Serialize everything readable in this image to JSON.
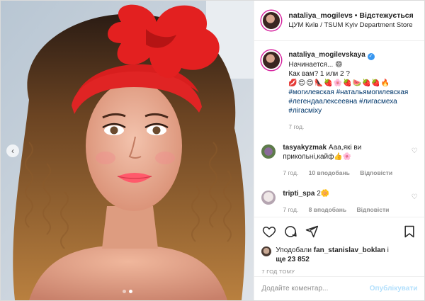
{
  "post": {
    "photo_alt": "",
    "carousel": {
      "count": 2,
      "active": 1
    },
    "header": {
      "username": "nataliya_mogilevs",
      "separator": "•",
      "follow_label": "Відстежується",
      "location": "ЦУМ Київ / TSUM Kyiv Department Store"
    },
    "caption": {
      "username": "nataliya_mogilevskaya",
      "line1": "Начинается... 😄",
      "line2": "Как вам? 1 или 2 ?",
      "emoji_line": "💋😍😍👠🍓🌸🍓🍉🍓🍓🔥",
      "hashtags": [
        "#могилевская #натальямогилевская",
        "#легендаалексеевна #лигасмеха",
        "#лігасміху"
      ],
      "time": "7 год."
    },
    "comments": [
      {
        "username": "tasyakyzmak",
        "text": "Ааа,які ви прикольні,кайф👍🌸",
        "time": "7 год.",
        "likes": "10 вподобань",
        "reply": "Відповісти"
      },
      {
        "username": "tripti_spa",
        "text": "2🌼",
        "time": "7 год.",
        "likes": "8 вподобань",
        "reply": "Відповісти"
      }
    ],
    "likes": {
      "prefix": "Уподобали",
      "user": "fan_stanislav_boklan",
      "suffix": "і",
      "more": "ще 23 852"
    },
    "timestamp": "7 ГОД ТОМУ",
    "add_comment_placeholder": "Додайте коментар...",
    "publish_label": "Опублікувати"
  }
}
